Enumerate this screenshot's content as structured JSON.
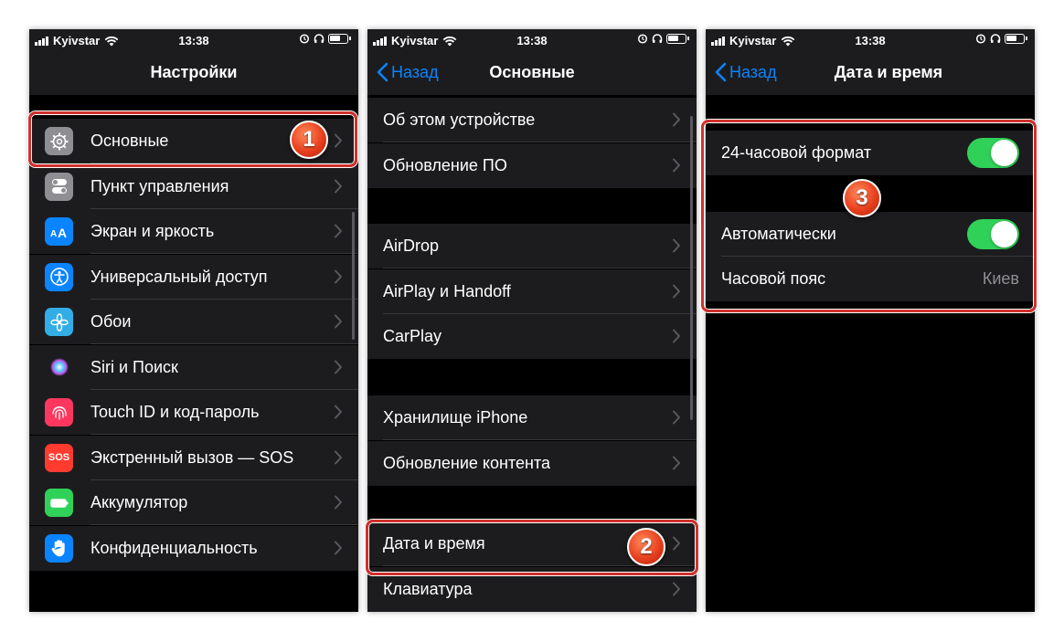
{
  "status_bar": {
    "carrier": "Kyivstar",
    "time": "13:38"
  },
  "screen1": {
    "title": "Настройки",
    "items": [
      {
        "label": "Основные",
        "icon": "gear-icon",
        "color": "#8e8e93"
      },
      {
        "label": "Пункт управления",
        "icon": "toggles-icon",
        "color": "#8e8e93"
      },
      {
        "label": "Экран и яркость",
        "icon": "text-size-icon",
        "color": "#0a84ff"
      },
      {
        "label": "Универсальный доступ",
        "icon": "accessibility-icon",
        "color": "#0a84ff"
      },
      {
        "label": "Обои",
        "icon": "flower-icon",
        "color": "#32ade6"
      },
      {
        "label": "Siri и Поиск",
        "icon": "siri-icon",
        "color": "#1c1c1e"
      },
      {
        "label": "Touch ID и код-пароль",
        "icon": "fingerprint-icon",
        "color": "#ff375f"
      },
      {
        "label": "Экстренный вызов — SOS",
        "icon": "sos-icon",
        "color": "#ff3b30",
        "icon_text": "SOS"
      },
      {
        "label": "Аккумулятор",
        "icon": "battery-icon",
        "color": "#30d158"
      },
      {
        "label": "Конфиденциальность",
        "icon": "hand-icon",
        "color": "#0a84ff"
      }
    ]
  },
  "screen2": {
    "back": "Назад",
    "title": "Основные",
    "groups": [
      [
        "Об этом устройстве",
        "Обновление ПО"
      ],
      [
        "AirDrop",
        "AirPlay и Handoff",
        "CarPlay"
      ],
      [
        "Хранилище iPhone",
        "Обновление контента"
      ],
      [
        "Дата и время",
        "Клавиатура"
      ]
    ]
  },
  "screen3": {
    "back": "Назад",
    "title": "Дата и время",
    "format_24": {
      "label": "24-часовой формат",
      "on": true
    },
    "auto": {
      "label": "Автоматически",
      "on": true
    },
    "timezone": {
      "label": "Часовой пояс",
      "value": "Киев"
    }
  },
  "annotations": {
    "step1": "1",
    "step2": "2",
    "step3": "3"
  },
  "colors": {
    "accent": "#0a84ff",
    "toggle_on": "#30d158",
    "highlight": "#d0312d"
  }
}
